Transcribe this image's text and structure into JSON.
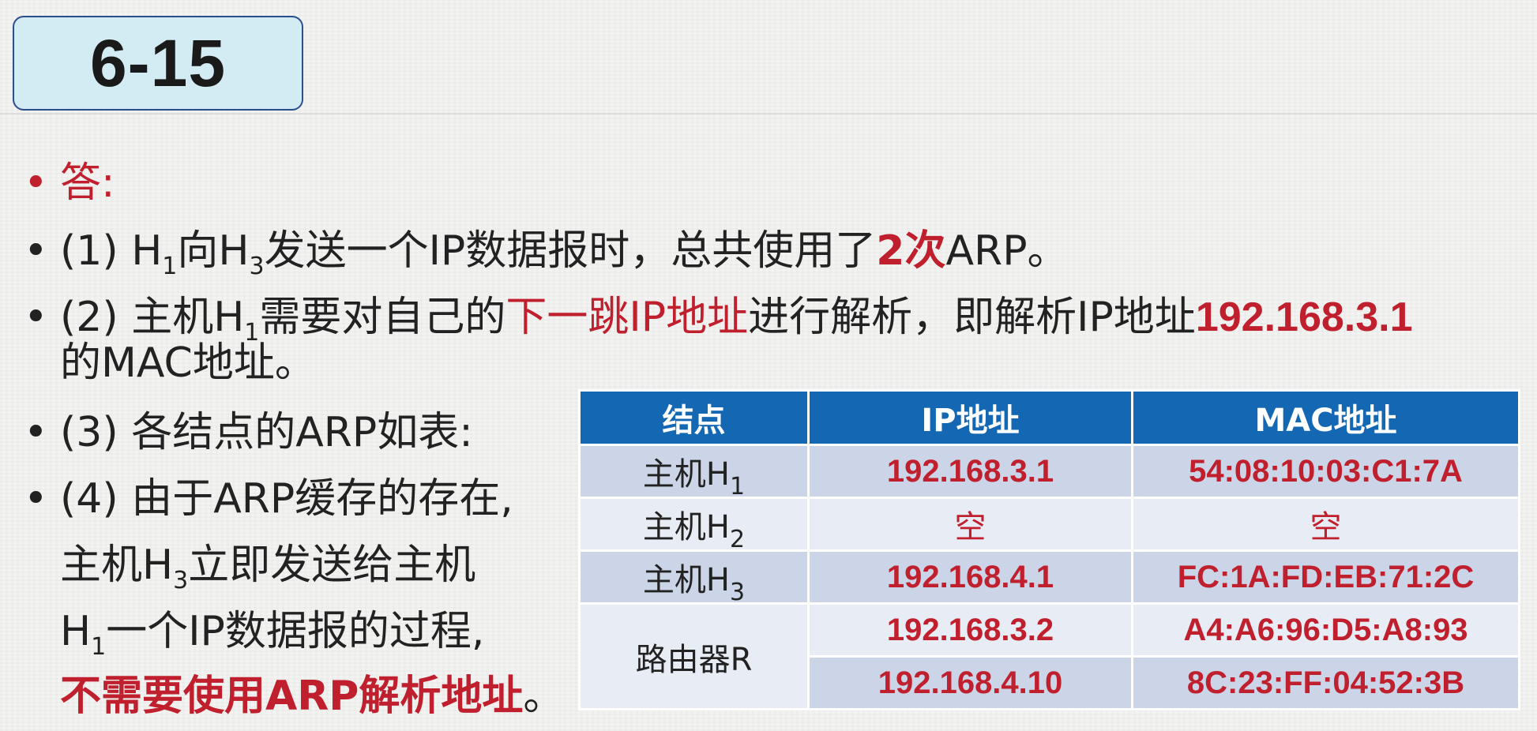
{
  "title": "6-15",
  "answer_label": "答:",
  "p1": {
    "pre": "(1) H",
    "s1": "1",
    "mid": "向H",
    "s2": "3",
    "post": "发送一个IP数据报时，总共使用了",
    "red": "2次",
    "end": "ARP。"
  },
  "p2": {
    "pre": "(2) 主机H",
    "s1": "1",
    "mid": "需要对自己的",
    "red": "下一跳IP地址",
    "post": "进行解析，即解析IP地址",
    "redb": "192.168.3.1",
    "line2": "的MAC地址。"
  },
  "p3": {
    "text": "(3) 各结点的ARP如表:"
  },
  "p4": {
    "line1": "(4) 由于ARP缓存的存在,",
    "line2_pre": "主机H",
    "line2_sub": "3",
    "line2_post": "立即发送给主机",
    "line3_pre": "H",
    "line3_sub": "1",
    "line3_post": "一个IP数据报的过程,",
    "line4_red": "不需要使用ARP解析地址",
    "line4_end": "。"
  },
  "table": {
    "headers": [
      "结点",
      "IP地址",
      "MAC地址"
    ],
    "rows": [
      {
        "node": "主机H",
        "sub": "1",
        "ip": "192.168.3.1",
        "mac": "54:08:10:03:C1:7A"
      },
      {
        "node": "主机H",
        "sub": "2",
        "ip": "空",
        "mac": "空"
      },
      {
        "node": "主机H",
        "sub": "3",
        "ip": "192.168.4.1",
        "mac": "FC:1A:FD:EB:71:2C"
      },
      {
        "node": "路由器R",
        "ip": "192.168.3.2",
        "mac": "A4:A6:96:D5:A8:93"
      },
      {
        "ip": "192.168.4.10",
        "mac": "8C:23:FF:04:52:3B"
      }
    ]
  }
}
